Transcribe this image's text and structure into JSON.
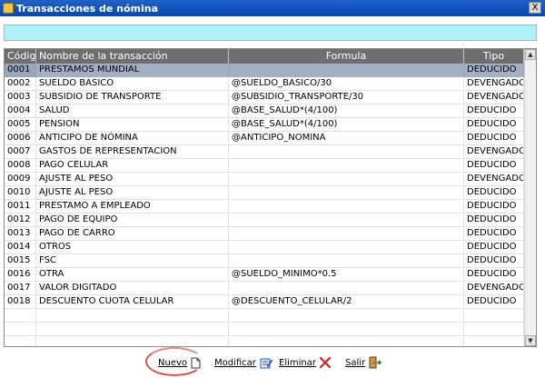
{
  "window": {
    "title": "Transacciones de nómina",
    "close_glyph": "X"
  },
  "search": {
    "value": ""
  },
  "table": {
    "headers": {
      "code": "Código",
      "name": "Nombre de la transacción",
      "formula": "Formula",
      "type": "Tipo"
    },
    "selected_index": 0,
    "rows": [
      {
        "code": "0001",
        "name": "PRESTAMOS MUNDIAL",
        "formula": "",
        "type": "DEDUCIDO"
      },
      {
        "code": "0002",
        "name": "SUELDO BASICO",
        "formula": "@SUELDO_BASICO/30",
        "type": "DEVENGADO"
      },
      {
        "code": "0003",
        "name": "SUBSIDIO DE TRANSPORTE",
        "formula": "@SUBSIDIO_TRANSPORTE/30",
        "type": "DEVENGADO"
      },
      {
        "code": "0004",
        "name": "SALUD",
        "formula": "@BASE_SALUD*(4/100)",
        "type": "DEDUCIDO"
      },
      {
        "code": "0005",
        "name": "PENSION",
        "formula": "@BASE_SALUD*(4/100)",
        "type": "DEDUCIDO"
      },
      {
        "code": "0006",
        "name": "ANTICIPO DE NÓMINA",
        "formula": "@ANTICIPO_NOMINA",
        "type": "DEDUCIDO"
      },
      {
        "code": "0007",
        "name": "GASTOS DE REPRESENTACION",
        "formula": "",
        "type": "DEVENGADO"
      },
      {
        "code": "0008",
        "name": "PAGO CELULAR",
        "formula": "",
        "type": "DEDUCIDO"
      },
      {
        "code": "0009",
        "name": "AJUSTE AL PESO",
        "formula": "",
        "type": "DEVENGADO"
      },
      {
        "code": "0010",
        "name": "AJUSTE AL PESO",
        "formula": "",
        "type": "DEDUCIDO"
      },
      {
        "code": "0011",
        "name": "PRESTAMO A EMPLEADO",
        "formula": "",
        "type": "DEDUCIDO"
      },
      {
        "code": "0012",
        "name": "PAGO DE EQUIPO",
        "formula": "",
        "type": "DEDUCIDO"
      },
      {
        "code": "0013",
        "name": "PAGO DE CARRO",
        "formula": "",
        "type": "DEDUCIDO"
      },
      {
        "code": "0014",
        "name": "OTROS",
        "formula": "",
        "type": "DEDUCIDO"
      },
      {
        "code": "0015",
        "name": "FSC",
        "formula": "",
        "type": "DEDUCIDO"
      },
      {
        "code": "0016",
        "name": "OTRA",
        "formula": "@SUELDO_MINIMO*0.5",
        "type": "DEDUCIDO"
      },
      {
        "code": "0017",
        "name": "VALOR DIGITADO",
        "formula": "",
        "type": "DEVENGADO"
      },
      {
        "code": "0018",
        "name": "DESCUENTO CUOTA CELULAR",
        "formula": "@DESCUENTO_CELULAR/2",
        "type": "DEDUCIDO"
      },
      {
        "code": "",
        "name": "",
        "formula": "",
        "type": ""
      },
      {
        "code": "",
        "name": "",
        "formula": "",
        "type": ""
      },
      {
        "code": "",
        "name": "",
        "formula": "",
        "type": ""
      }
    ]
  },
  "toolbar": {
    "new_label": "Nuevo",
    "edit_label": "Modificar",
    "delete_label": "Eliminar",
    "exit_label": "Salir"
  },
  "icons": {
    "app": "app-icon",
    "new": "new-document-icon",
    "edit": "edit-pencil-icon",
    "delete": "red-x-icon",
    "exit": "exit-door-icon"
  }
}
